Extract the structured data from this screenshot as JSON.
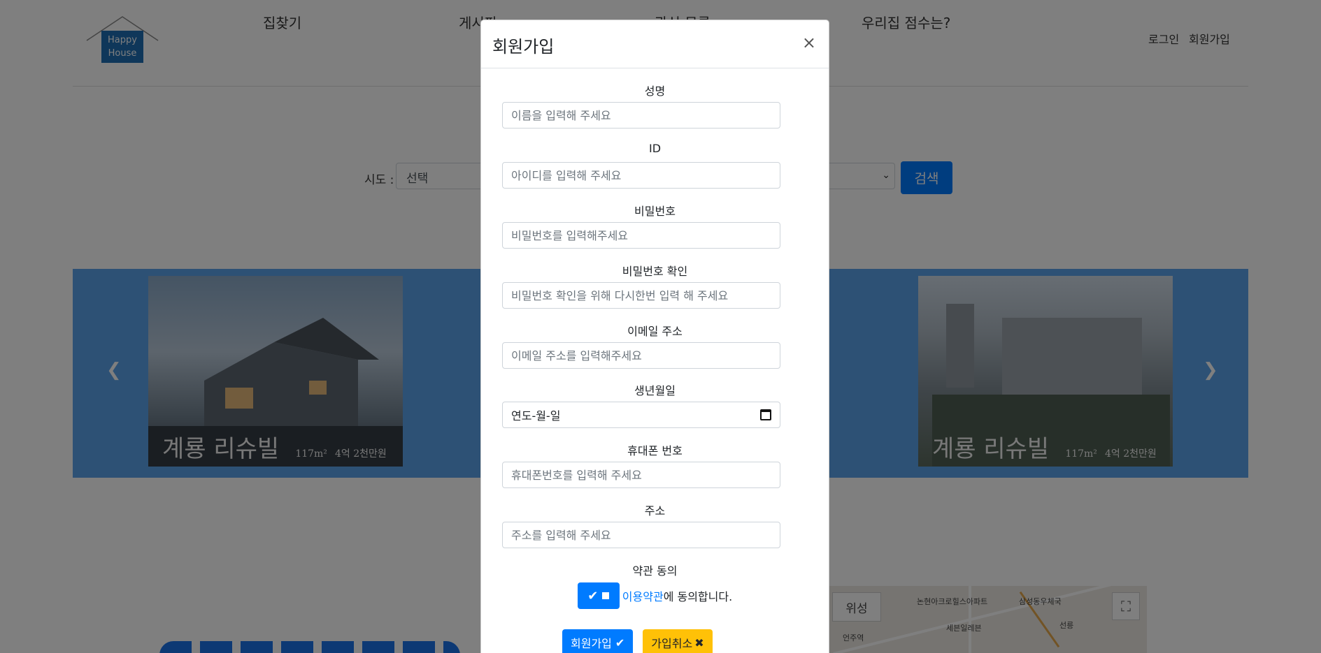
{
  "logo": {
    "line1": "Happy",
    "line2": "House"
  },
  "nav": {
    "items": [
      "집찾기",
      "게시판",
      "관심 목록",
      "우리집 점수는?"
    ]
  },
  "auth": {
    "login": "로그인",
    "signup": "회원가입"
  },
  "search": {
    "sido_label": "시도 :",
    "sido_value": "선택",
    "button": "검색"
  },
  "carousel": {
    "slides": [
      {
        "name": "계룡 리슈빌",
        "meta_area": "117m²",
        "meta_price": "4억 2천만원"
      },
      {
        "name": "계룡 리슈빌",
        "meta_area": "117m²",
        "meta_price": "4억 2천만원"
      }
    ],
    "prev_icon": "chevron-left-icon",
    "next_icon": "chevron-right-icon"
  },
  "map": {
    "type_button": "위성",
    "labels": [
      "논현아크로힐스아파트",
      "삼성동우체국",
      "세븐일레븐",
      "언주역",
      "선릉"
    ]
  },
  "modal": {
    "title": "회원가입",
    "close": "×",
    "fields": {
      "name": {
        "label": "성명",
        "placeholder": "이름을 입력해 주세요"
      },
      "id": {
        "label": "ID",
        "placeholder": "아이디를 입력해 주세요"
      },
      "password": {
        "label": "비밀번호",
        "placeholder": "비밀번호를 입력해주세요"
      },
      "password_confirm": {
        "label": "비밀번호 확인",
        "placeholder": "비밀번호 확인을 위해 다시한번 입력 해 주세요"
      },
      "email": {
        "label": "이메일 주소",
        "placeholder": "이메일 주소를 입력해주세요"
      },
      "birth": {
        "label": "생년월일",
        "value": "연도-월-일"
      },
      "phone": {
        "label": "휴대폰 번호",
        "placeholder": "휴대폰번호를 입력해 주세요"
      },
      "address": {
        "label": "주소",
        "placeholder": "주소를 입력해 주세요"
      }
    },
    "terms": {
      "label": "약관 동의",
      "link": "이용약관",
      "suffix": "에 동의합니다."
    },
    "buttons": {
      "join": "회원가입",
      "cancel": "가입취소"
    }
  }
}
